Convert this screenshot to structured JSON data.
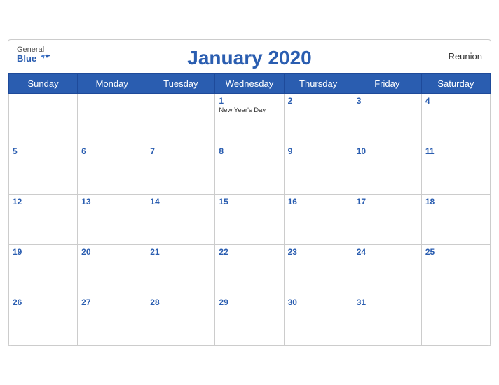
{
  "calendar": {
    "title": "January 2020",
    "region": "Reunion",
    "logo": {
      "general": "General",
      "blue": "Blue"
    },
    "days_of_week": [
      "Sunday",
      "Monday",
      "Tuesday",
      "Wednesday",
      "Thursday",
      "Friday",
      "Saturday"
    ],
    "weeks": [
      [
        {
          "date": "",
          "holiday": ""
        },
        {
          "date": "",
          "holiday": ""
        },
        {
          "date": "",
          "holiday": ""
        },
        {
          "date": "1",
          "holiday": "New Year's Day"
        },
        {
          "date": "2",
          "holiday": ""
        },
        {
          "date": "3",
          "holiday": ""
        },
        {
          "date": "4",
          "holiday": ""
        }
      ],
      [
        {
          "date": "5",
          "holiday": ""
        },
        {
          "date": "6",
          "holiday": ""
        },
        {
          "date": "7",
          "holiday": ""
        },
        {
          "date": "8",
          "holiday": ""
        },
        {
          "date": "9",
          "holiday": ""
        },
        {
          "date": "10",
          "holiday": ""
        },
        {
          "date": "11",
          "holiday": ""
        }
      ],
      [
        {
          "date": "12",
          "holiday": ""
        },
        {
          "date": "13",
          "holiday": ""
        },
        {
          "date": "14",
          "holiday": ""
        },
        {
          "date": "15",
          "holiday": ""
        },
        {
          "date": "16",
          "holiday": ""
        },
        {
          "date": "17",
          "holiday": ""
        },
        {
          "date": "18",
          "holiday": ""
        }
      ],
      [
        {
          "date": "19",
          "holiday": ""
        },
        {
          "date": "20",
          "holiday": ""
        },
        {
          "date": "21",
          "holiday": ""
        },
        {
          "date": "22",
          "holiday": ""
        },
        {
          "date": "23",
          "holiday": ""
        },
        {
          "date": "24",
          "holiday": ""
        },
        {
          "date": "25",
          "holiday": ""
        }
      ],
      [
        {
          "date": "26",
          "holiday": ""
        },
        {
          "date": "27",
          "holiday": ""
        },
        {
          "date": "28",
          "holiday": ""
        },
        {
          "date": "29",
          "holiday": ""
        },
        {
          "date": "30",
          "holiday": ""
        },
        {
          "date": "31",
          "holiday": ""
        },
        {
          "date": "",
          "holiday": ""
        }
      ]
    ]
  }
}
